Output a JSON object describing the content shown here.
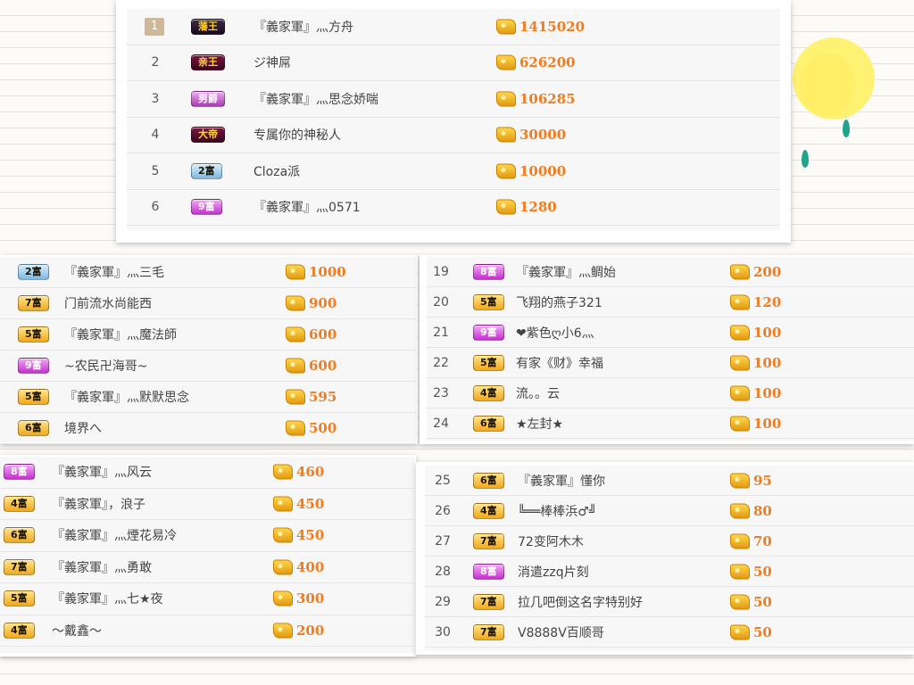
{
  "colors": {
    "amount": "#f07c1f",
    "badge_gold": "#f0a81e",
    "badge_purple": "#c42fcf",
    "badge_blue": "#7fb8e0"
  },
  "icons": {
    "coin": "gold-coin-stack-icon"
  },
  "top_panel": {
    "rows": [
      {
        "rank": "1",
        "badge": "藩王",
        "name": "『義家軍』灬方舟",
        "amount": "1415020"
      },
      {
        "rank": "2",
        "badge": "亲王",
        "name": "ジ神屌",
        "amount": "626200"
      },
      {
        "rank": "3",
        "badge": "男爵",
        "name": "『義家軍』灬思念娇喘",
        "amount": "106285"
      },
      {
        "rank": "4",
        "badge": "大帝",
        "name": "专属你的神秘人",
        "amount": "30000"
      },
      {
        "rank": "5",
        "badge": "2富",
        "name": "Cloza派",
        "amount": "10000"
      },
      {
        "rank": "6",
        "badge": "9富",
        "name": "『義家軍』灬0571",
        "amount": "1280"
      }
    ]
  },
  "mid_left": {
    "rows": [
      {
        "badge": "2富",
        "name": "『義家軍』灬三毛",
        "amount": "1000"
      },
      {
        "badge": "7富",
        "name": "门前流水尚能西",
        "amount": "900"
      },
      {
        "badge": "5富",
        "name": "『義家軍』灬魔法師",
        "amount": "600"
      },
      {
        "badge": "9富",
        "name": "~农民卍海哥~",
        "amount": "600"
      },
      {
        "badge": "5富",
        "name": "『義家軍』灬默默思念",
        "amount": "595"
      },
      {
        "badge": "6富",
        "name": "境界へ",
        "amount": "500"
      }
    ]
  },
  "mid_right": {
    "rows": [
      {
        "rank": "19",
        "badge": "8富",
        "name": "『義家軍』灬鲷始",
        "amount": "200"
      },
      {
        "rank": "20",
        "badge": "5富",
        "name": "飞翔的燕子321",
        "amount": "120"
      },
      {
        "rank": "21",
        "badge": "9富",
        "name": "❤紫色ღ小6灬",
        "amount": "100"
      },
      {
        "rank": "22",
        "badge": "5富",
        "name": "有家《财》幸福",
        "amount": "100"
      },
      {
        "rank": "23",
        "badge": "4富",
        "name": "流。。云",
        "amount": "100"
      },
      {
        "rank": "24",
        "badge": "6富",
        "name": "★左封★",
        "amount": "100"
      }
    ]
  },
  "bottom_left": {
    "rows": [
      {
        "badge": "8富",
        "name": "『義家軍』灬风云",
        "amount": "460"
      },
      {
        "badge": "4富",
        "name": "『義家軍』，浪子",
        "amount": "450"
      },
      {
        "badge": "6富",
        "name": "『義家軍』灬煙花易冷",
        "amount": "450"
      },
      {
        "badge": "7富",
        "name": "『義家軍』灬勇敢",
        "amount": "400"
      },
      {
        "badge": "5富",
        "name": "『義家軍』灬七★夜",
        "amount": "300"
      },
      {
        "badge": "4富",
        "name": "～戴鑫～",
        "amount": "200"
      }
    ]
  },
  "bottom_right": {
    "rows": [
      {
        "rank": "25",
        "badge": "6富",
        "name": "『義家軍』懂你",
        "amount": "95"
      },
      {
        "rank": "26",
        "badge": "4富",
        "name": "╚══棒棒浜♂╝",
        "amount": "80"
      },
      {
        "rank": "27",
        "badge": "7富",
        "name": "72变阿木木",
        "amount": "70"
      },
      {
        "rank": "28",
        "badge": "8富",
        "name": "消遣zzq片刻",
        "amount": "50"
      },
      {
        "rank": "29",
        "badge": "7富",
        "name": "拉几吧倒这名字特别好",
        "amount": "50"
      },
      {
        "rank": "30",
        "badge": "7富",
        "name": "V8888V百顺哥",
        "amount": "50"
      }
    ]
  }
}
